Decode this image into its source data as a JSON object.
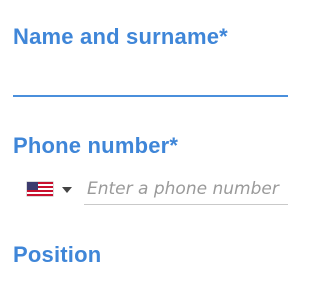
{
  "form": {
    "name_field": {
      "label": "Name and surname*",
      "value": ""
    },
    "phone_field": {
      "label": "Phone number*",
      "country_flag": "us-flag-icon",
      "placeholder": "Enter a phone number",
      "value": ""
    },
    "position_field": {
      "label": "Position"
    }
  },
  "colors": {
    "label": "#3f86d8",
    "active_underline": "#4a8fdc",
    "inactive_underline": "#c9c9c9",
    "placeholder": "#9a9a9a"
  }
}
